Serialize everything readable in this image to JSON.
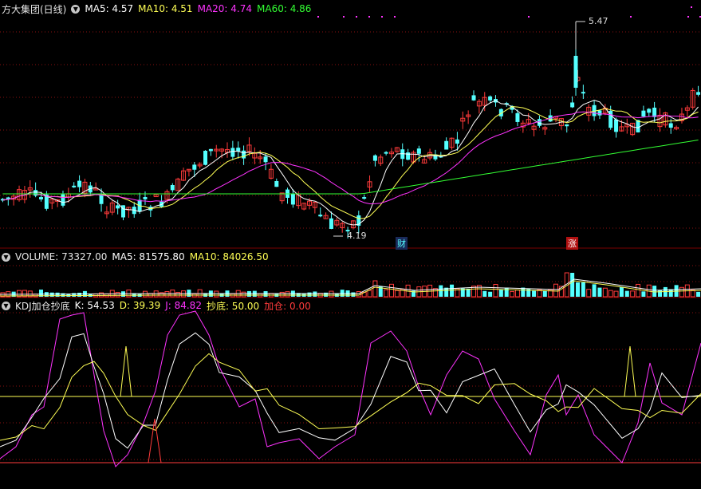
{
  "price_panel": {
    "name": "方大集团(日线)",
    "ma5": "MA5: 4.57",
    "ma10": "MA10: 4.51",
    "ma20": "MA20: 4.74",
    "ma60": "MA60: 4.86",
    "high_label": "5.47",
    "low_label": "4.19",
    "tag_cai": "财",
    "tag_zhang": "涨",
    "colors": {
      "up": "#ff3b3b",
      "down": "#54ffff",
      "ma5": "#ffffff",
      "ma10": "#ffff55",
      "ma20": "#ff33ff",
      "ma60": "#33ff33"
    }
  },
  "volume_panel": {
    "volume": "VOLUME: 73327.00",
    "ma5": "MA5: 81575.80",
    "ma10": "MA10: 84026.50"
  },
  "kdj_panel": {
    "name": "KDJ加仓抄底",
    "k": "K: 54.53",
    "d": "D: 39.39",
    "j": "J: 84.82",
    "chaodi": "抄底: 50.00",
    "jiacang": "加仓: 0.00"
  }
}
